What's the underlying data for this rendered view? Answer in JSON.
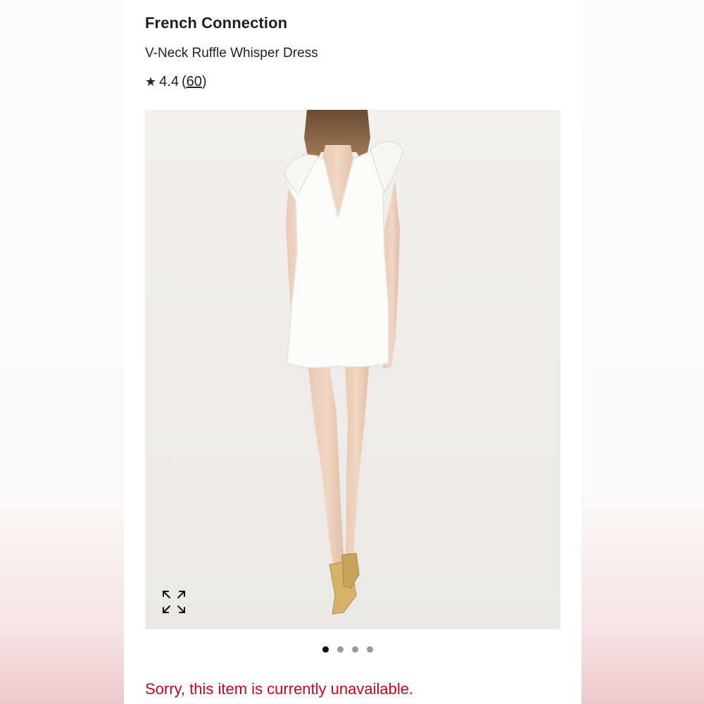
{
  "product": {
    "brand": "French Connection",
    "name": "V-Neck Ruffle Whisper Dress",
    "rating": {
      "star": "★",
      "value": "4.4",
      "open_paren": "(",
      "count": "60",
      "close_paren": ")"
    }
  },
  "gallery": {
    "image_icon": "product-photo",
    "expand_icon": "expand-icon",
    "dots": [
      {
        "active": true
      },
      {
        "active": false
      },
      {
        "active": false
      },
      {
        "active": false
      }
    ]
  },
  "status": {
    "message": "Sorry, this item is currently unavailable.",
    "color": "#d0021b"
  }
}
